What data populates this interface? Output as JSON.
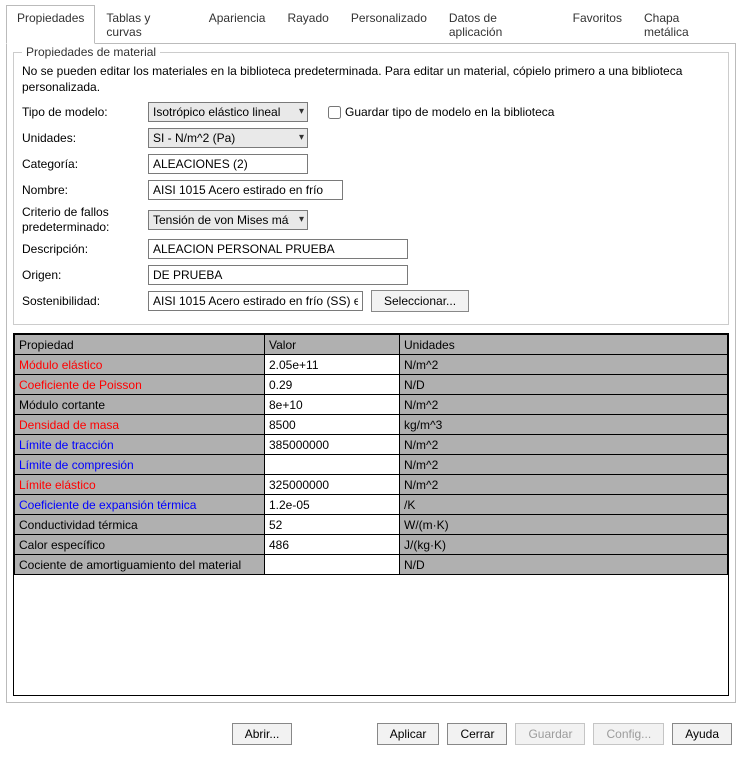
{
  "tabs": [
    {
      "label": "Propiedades",
      "active": true
    },
    {
      "label": "Tablas y curvas",
      "active": false
    },
    {
      "label": "Apariencia",
      "active": false
    },
    {
      "label": "Rayado",
      "active": false
    },
    {
      "label": "Personalizado",
      "active": false
    },
    {
      "label": "Datos de aplicación",
      "active": false
    },
    {
      "label": "Favoritos",
      "active": false
    },
    {
      "label": "Chapa metálica",
      "active": false
    }
  ],
  "fieldset": {
    "legend": "Propiedades de material",
    "info": "No se pueden editar los materiales en la biblioteca predeterminada. Para editar un material, cópielo primero a una biblioteca personalizada."
  },
  "form": {
    "tipo_modelo": {
      "label": "Tipo de modelo:",
      "value": "Isotrópico elástico lineal"
    },
    "unidades": {
      "label": "Unidades:",
      "value": "SI - N/m^2 (Pa)"
    },
    "categoria": {
      "label": "Categoría:",
      "value": "ALEACIONES (2)"
    },
    "nombre": {
      "label": "Nombre:",
      "value": "AISI 1015 Acero estirado en frío"
    },
    "criterio": {
      "label_1": "Criterio de fallos",
      "label_2": "predeterminado:",
      "value": "Tensión de von Mises máx."
    },
    "descripcion": {
      "label": "Descripción:",
      "value": "ALEACION PERSONAL PRUEBA"
    },
    "origen": {
      "label": "Origen:",
      "value": "DE PRUEBA"
    },
    "sosten": {
      "label": "Sostenibilidad:",
      "value": "AISI 1015 Acero estirado en frío (SS) e"
    },
    "guardar_checkbox": "Guardar tipo de modelo en la biblioteca",
    "seleccionar_btn": "Seleccionar..."
  },
  "table": {
    "headers": {
      "prop": "Propiedad",
      "valor": "Valor",
      "unidades": "Unidades"
    },
    "rows": [
      {
        "name": "Módulo elástico",
        "value": "2.05e+11",
        "units": "N/m^2",
        "color": "red"
      },
      {
        "name": "Coeficiente de Poisson",
        "value": "0.29",
        "units": "N/D",
        "color": "red"
      },
      {
        "name": "Módulo cortante",
        "value": "8e+10",
        "units": "N/m^2",
        "color": "black"
      },
      {
        "name": "Densidad de masa",
        "value": "8500",
        "units": "kg/m^3",
        "color": "red"
      },
      {
        "name": "Límite de tracción",
        "value": "385000000",
        "units": "N/m^2",
        "color": "blue"
      },
      {
        "name": "Límite de compresión",
        "value": "",
        "units": "N/m^2",
        "color": "blue"
      },
      {
        "name": "Límite elástico",
        "value": "325000000",
        "units": "N/m^2",
        "color": "red"
      },
      {
        "name": "Coeficiente de expansión térmica",
        "value": "1.2e-05",
        "units": "/K",
        "color": "blue"
      },
      {
        "name": "Conductividad térmica",
        "value": "52",
        "units": "W/(m·K)",
        "color": "black"
      },
      {
        "name": "Calor específico",
        "value": "486",
        "units": "J/(kg·K)",
        "color": "black"
      },
      {
        "name": "Cociente de amortiguamiento del material",
        "value": "",
        "units": "N/D",
        "color": "black"
      }
    ]
  },
  "footer": {
    "abrir": "Abrir...",
    "aplicar": "Aplicar",
    "cerrar": "Cerrar",
    "guardar": "Guardar",
    "config": "Config...",
    "ayuda": "Ayuda"
  }
}
